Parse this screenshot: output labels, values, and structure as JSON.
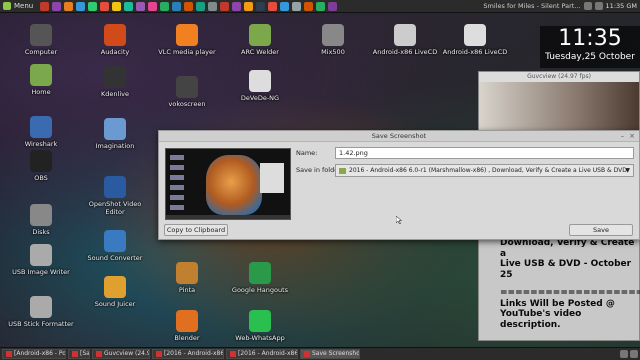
{
  "top_panel": {
    "menu_label": "Menu",
    "now_playing": "Smiles for Miles - Silent Part...",
    "clock": "11:35 GM",
    "launcher_colors": [
      "#c0392b",
      "#8e44ad",
      "#e67e22",
      "#3498db",
      "#2ecc71",
      "#e74c3c",
      "#f1c40f",
      "#1abc9c",
      "#9b59b6",
      "#e84393",
      "#27ae60",
      "#2980b9",
      "#d35400",
      "#16a085",
      "#7f8c8d",
      "#c0392b",
      "#8e44ad",
      "#f39c12",
      "#2c3e50",
      "#e74c3c",
      "#3498db",
      "#95a5a6",
      "#d35400",
      "#27ae60",
      "#7d3c98"
    ]
  },
  "desktop_icons": [
    {
      "label": "Computer",
      "icon": "computer-icon",
      "color": "#555"
    },
    {
      "label": "Home",
      "icon": "home-folder-icon",
      "color": "#7aa84a"
    },
    {
      "label": "Wireshark",
      "icon": "wireshark-icon",
      "color": "#3a6ab0"
    },
    {
      "label": "OBS",
      "icon": "obs-icon",
      "color": "#222"
    },
    {
      "label": "Disks",
      "icon": "disks-icon",
      "color": "#888"
    },
    {
      "label": "USB Image Writer",
      "icon": "usb-image-writer-icon",
      "color": "#aaa"
    },
    {
      "label": "USB Stick Formatter",
      "icon": "usb-formatter-icon",
      "color": "#aaa"
    },
    {
      "label": "Audacity",
      "icon": "audacity-icon",
      "color": "#d04a1a"
    },
    {
      "label": "Kdenlive",
      "icon": "kdenlive-icon",
      "color": "#333"
    },
    {
      "label": "Imagination",
      "icon": "imagination-icon",
      "color": "#6a9ad0"
    },
    {
      "label": "OpenShot Video Editor",
      "icon": "openshot-icon",
      "color": "#2a5aa0"
    },
    {
      "label": "Sound Converter",
      "icon": "sound-converter-icon",
      "color": "#3a7ac0"
    },
    {
      "label": "Sound Juicer",
      "icon": "sound-juicer-icon",
      "color": "#e0a030"
    },
    {
      "label": "VLC media player",
      "icon": "vlc-icon",
      "color": "#f08020"
    },
    {
      "label": "vokoscreen",
      "icon": "vokoscreen-icon",
      "color": "#444"
    },
    {
      "label": "Pinta",
      "icon": "pinta-icon",
      "color": "#c08030"
    },
    {
      "label": "Blender",
      "icon": "blender-icon",
      "color": "#e07020"
    },
    {
      "label": "ARC Welder",
      "icon": "arc-welder-icon",
      "color": "#7aa84a"
    },
    {
      "label": "DeVeDe-NG",
      "icon": "devede-icon",
      "color": "#ddd"
    },
    {
      "label": "Google Hangouts",
      "icon": "hangouts-icon",
      "color": "#2a9a4a"
    },
    {
      "label": "Web-WhatsApp",
      "icon": "whatsapp-icon",
      "color": "#2ac050"
    },
    {
      "label": "Mix500",
      "icon": "mix500-folder-icon",
      "color": "#888"
    },
    {
      "label": "Android-x86 LiveCD",
      "icon": "drive-icon",
      "color": "#ccc"
    },
    {
      "label": "Android-x86 LiveCD",
      "icon": "dvd-icon",
      "color": "#ddd"
    }
  ],
  "clock_widget": {
    "time": "11:35",
    "date": "Tuesday,25 October"
  },
  "guvcview": {
    "title": "Guvcview  (24.97 fps)",
    "overlay_lines": [
      "Download, Verify & Create a",
      "Live USB & DVD - October 25",
      "",
      "=====================",
      "Links Will be Posted @",
      "YouTube's video description."
    ]
  },
  "dialog": {
    "title": "Save Screenshot",
    "name_label": "Name:",
    "name_value": "1.42.png",
    "folder_label": "Save in folder:",
    "folder_value": "2016 - Android-x86 6.0-r1 (Marshmallow-x86) , Download, Verify & Create a Live USB & DVD - October 25",
    "copy_button": "Copy to Clipboard",
    "save_button": "Save"
  },
  "taskbar": {
    "tasks": [
      {
        "label": "[Android-x86 - Portin...",
        "active": false
      },
      {
        "label": "[Sam...",
        "active": false
      },
      {
        "label": "Guvcview  (24.97 fps)",
        "active": false
      },
      {
        "label": "[2016 - Android-x86 ...",
        "active": false
      },
      {
        "label": "[2016 - Android-x86 ...",
        "active": false
      },
      {
        "label": "Save Screenshot",
        "active": true
      }
    ]
  }
}
